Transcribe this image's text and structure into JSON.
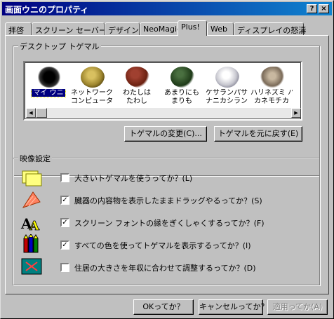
{
  "window": {
    "title": "画面ウニのプロパティ",
    "help_btn": "?",
    "close_btn": "×"
  },
  "tabs": [
    {
      "label": "拝啓",
      "active": false
    },
    {
      "label": "スクリーン セーバー",
      "active": false
    },
    {
      "label": "デザイン",
      "active": false
    },
    {
      "label": "NeoMagic",
      "active": false
    },
    {
      "label": "Plus!",
      "active": true
    },
    {
      "label": "Web",
      "active": false
    },
    {
      "label": "ディスプレイの怒濤",
      "active": false
    }
  ],
  "desktop_group": {
    "legend": "デスクトップ トゲマル",
    "items": [
      {
        "label": "マイ ウニ",
        "icon": "sea-urchin-icon",
        "color": "#111111",
        "selected": true
      },
      {
        "label": "ネットワーク ウニ\nコンピュータ",
        "icon": "sponge-icon",
        "color": "#b09a3a",
        "selected": false
      },
      {
        "label": "わたしは\nたわし",
        "icon": "scrub-brush-icon",
        "color": "#7a2a1a",
        "selected": false
      },
      {
        "label": "あまりにも\nまりも",
        "icon": "marimo-icon",
        "color": "#2a4a20",
        "selected": false
      },
      {
        "label": "ケサランパサラン\nナニカシラン？",
        "icon": "fluff-ball-icon",
        "color": "#d8d8e0",
        "selected": false
      },
      {
        "label": "ハリネズミ ハ\nカネモチカ",
        "icon": "hedgehog-icon",
        "color": "#9a8a78",
        "selected": false
      }
    ],
    "scroll_left": "◀",
    "scroll_right": "▶",
    "change_button": "トゲマルの変更(C)...",
    "restore_button": "トゲマルを元に戻す(E)"
  },
  "video_group": {
    "legend": "映像設定",
    "options": [
      {
        "label": "大きいトゲマルを使うってか？(L)",
        "checked": false,
        "icon": "folder-icon",
        "icon_color": "#ffff80"
      },
      {
        "label": "臓器の内容物を表示したままドラッグやるってか？(S)",
        "checked": true,
        "icon": "drag-window-icon",
        "icon_color": "#ff8060"
      },
      {
        "label": "スクリーン フォントの縁をぎくしゃくするってか？(F)",
        "checked": true,
        "icon": "font-smoothing-icon",
        "icon_color": "#ffff00"
      },
      {
        "label": "すべての色を使ってトゲマルを表示するってか？(I)",
        "checked": true,
        "icon": "crayons-icon",
        "icon_color": "#c00000"
      },
      {
        "label": "住居の大きさを年収に合わせて調整するってか？(D)",
        "checked": false,
        "icon": "monitor-stretch-icon",
        "icon_color": "#008080"
      }
    ]
  },
  "footer": {
    "ok_button": "OKってか？",
    "cancel_button": "キャンセルってか？",
    "apply_button": "適用ってか(A)"
  }
}
